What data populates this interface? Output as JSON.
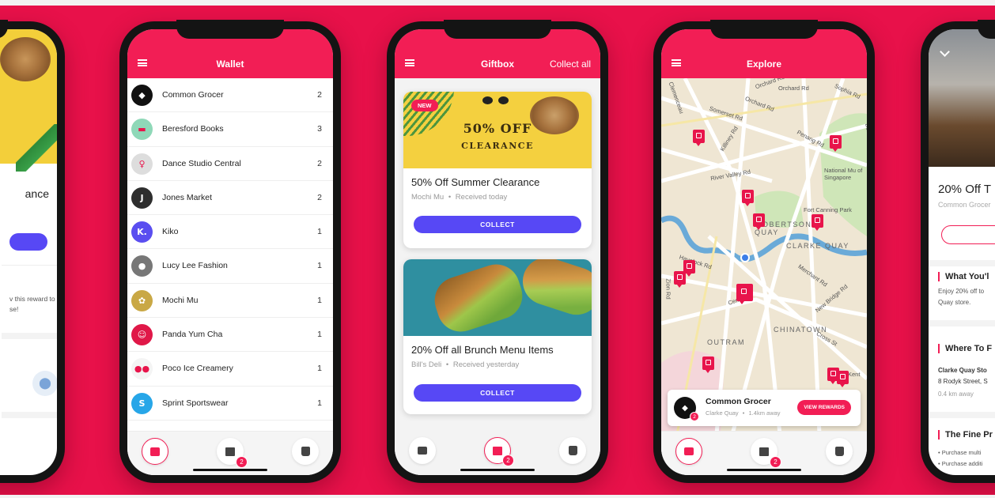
{
  "wallet": {
    "title": "Wallet",
    "items": [
      {
        "name": "Common Grocer",
        "count": "2",
        "bg": "#111111",
        "mark": "◆"
      },
      {
        "name": "Beresford Books",
        "count": "3",
        "bg": "#8fd8b8",
        "mark": "▬"
      },
      {
        "name": "Dance Studio Central",
        "count": "2",
        "bg": "#dddddd",
        "mark": "♀"
      },
      {
        "name": "Jones Market",
        "count": "2",
        "bg": "#2e2e2e",
        "mark": "J"
      },
      {
        "name": "Kiko",
        "count": "1",
        "bg": "#5a4ef0",
        "mark": "K."
      },
      {
        "name": "Lucy Lee Fashion",
        "count": "1",
        "bg": "#777777",
        "mark": "●"
      },
      {
        "name": "Mochi Mu",
        "count": "1",
        "bg": "#c9a845",
        "mark": "✿"
      },
      {
        "name": "Panda Yum Cha",
        "count": "1",
        "bg": "#e01848",
        "mark": "☺"
      },
      {
        "name": "Poco Ice Creamery",
        "count": "1",
        "bg": "#f4f4f4",
        "mark": "●●"
      },
      {
        "name": "Sprint Sportswear",
        "count": "1",
        "bg": "#27a6e8",
        "mark": "S"
      }
    ],
    "badge": "2"
  },
  "giftbox": {
    "title": "Giftbox",
    "collect_all": "Collect all",
    "new_tag": "NEW",
    "card1": {
      "img_line1": "50% OFF",
      "img_line2": "CLEARANCE",
      "title": "50% Off Summer Clearance",
      "store": "Mochi Mu",
      "received": "Received today",
      "button": "COLLECT"
    },
    "card2": {
      "title": "20% Off all Brunch Menu Items",
      "store": "Bill's Deli",
      "received": "Received yesterday",
      "button": "COLLECT"
    },
    "badge": "2",
    "sep": "•"
  },
  "explore": {
    "title": "Explore",
    "street_labels": [
      "Orchard Rd",
      "Somerset Rd",
      "Orchard Rd",
      "Killiney Rd",
      "Penang Rd",
      "River Valley Rd",
      "National Mu of Singapore",
      "Fort Canning Park",
      "Merchant Rd",
      "Havelock Rd",
      "Zion Rd",
      "Central",
      "New Bridge Rd",
      "Cross St",
      "Kent",
      "Orchard Rd",
      "Sophia Rd",
      "Bencoolen",
      "Clemenceau"
    ],
    "district_labels": [
      "ROBERTSON",
      "QUAY",
      "CLARKE QUAY",
      "CHINATOWN",
      "OUTRAM",
      "TANJONG"
    ],
    "card": {
      "name": "Common Grocer",
      "area": "Clarke Quay",
      "distance": "1.4km away",
      "button": "VIEW REWARDS",
      "badge": "2",
      "sep": "•"
    },
    "badge": "2"
  },
  "left_partial": {
    "title": "ance",
    "text_line1": "v this reward to",
    "text_line2": "se!"
  },
  "right_partial": {
    "title": "20% Off T",
    "store": "Common Grocer",
    "section1": "What You'l",
    "body1_line1": "Enjoy 20% off to",
    "body1_line2": "Quay store.",
    "section2": "Where To F",
    "addr1": "Clarke Quay Sto",
    "addr2": "8 Rodyk Street, S",
    "addr3": "0.4 km away",
    "section3": "The Fine Pr",
    "fine1": "• Purchase multi",
    "fine2": "• Purchase additi"
  },
  "colors": {
    "brand": "#f21e55",
    "accent": "#5748f5",
    "background": "#e8114a"
  }
}
